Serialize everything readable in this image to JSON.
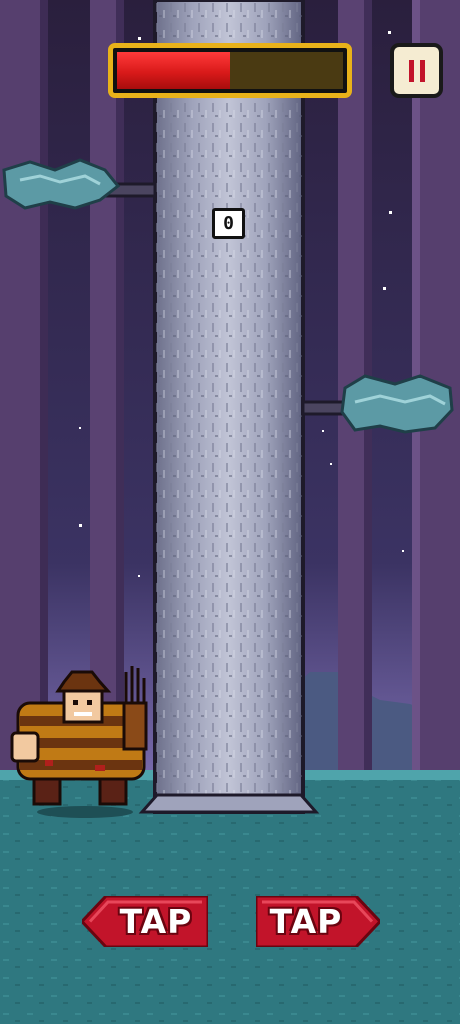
{
  "hud": {
    "score": "0",
    "time_remaining_fraction": 0.5,
    "pause_icon": "pause-icon"
  },
  "controls": {
    "tap_left_label": "TAP",
    "tap_right_label": "TAP"
  },
  "colors": {
    "sky_top": "#2a1f3d",
    "sky_bottom": "#7f70b4",
    "forest_trunk": "#563f6e",
    "ground": "#2f7880",
    "timer_fill": "#d91a1a",
    "timer_frame": "#e8b21a",
    "button_red": "#c2142a",
    "tree_bark": "#a3a7c0"
  }
}
